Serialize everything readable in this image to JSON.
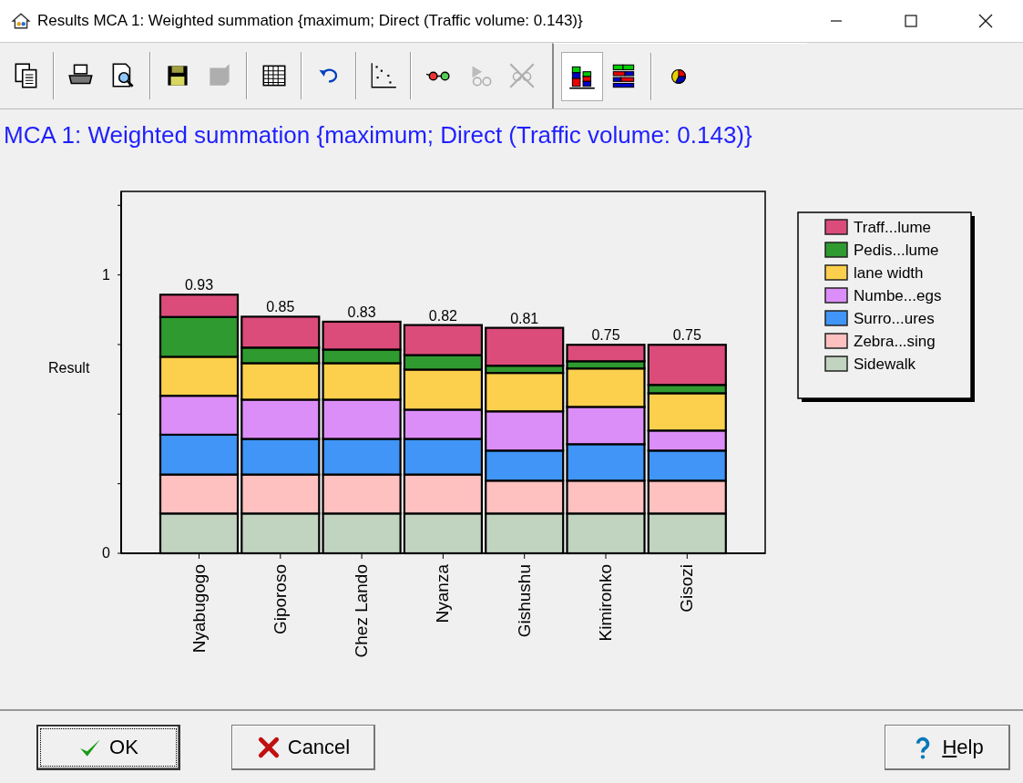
{
  "window": {
    "title": "Results MCA 1: Weighted summation {maximum; Direct (Traffic volume: 0.143)}"
  },
  "toolbar": [
    {
      "kind": "copy",
      "disabled": false
    },
    {
      "kind": "sep"
    },
    {
      "kind": "print",
      "disabled": false
    },
    {
      "kind": "preview",
      "disabled": false
    },
    {
      "kind": "sep"
    },
    {
      "kind": "save",
      "disabled": false
    },
    {
      "kind": "square",
      "disabled": true
    },
    {
      "kind": "sep"
    },
    {
      "kind": "table",
      "disabled": false
    },
    {
      "kind": "sep"
    },
    {
      "kind": "undo",
      "disabled": false
    },
    {
      "kind": "sep"
    },
    {
      "kind": "scatter",
      "disabled": false
    },
    {
      "kind": "sep"
    },
    {
      "kind": "glasses",
      "disabled": false
    },
    {
      "kind": "glasses2",
      "disabled": true
    },
    {
      "kind": "glassesx",
      "disabled": true
    }
  ],
  "view_toolbar": [
    {
      "kind": "stacked",
      "selected": true
    },
    {
      "kind": "hbars",
      "selected": false
    },
    {
      "kind": "sep"
    },
    {
      "kind": "pie",
      "selected": false
    }
  ],
  "heading": "MCA 1: Weighted summation {maximum; Direct (Traffic volume: 0.143)}",
  "chart": {
    "chart_data": {
      "type": "bar",
      "stacked": true,
      "legend": "right",
      "ylabel": "Result",
      "ylim": [
        0,
        1.3
      ],
      "yticks": [
        {
          "value": 0,
          "label": "0"
        },
        {
          "value": 1,
          "label": "1"
        }
      ],
      "categories": [
        "Nyabugogo",
        "Giporoso",
        "Chez Lando",
        "Nyanza",
        "Gishushu",
        "Kimironko",
        "Gisozi"
      ],
      "value_labels": [
        "0.93",
        "0.85",
        "0.83",
        "0.82",
        "0.81",
        "0.75",
        "0.75"
      ],
      "series": [
        {
          "name": "Traff...lume",
          "color": "#db4c7b",
          "values": [
            0.08,
            0.111,
            0.1,
            0.108,
            0.136,
            0.059,
            0.144
          ]
        },
        {
          "name": "Pedis...lume",
          "color": "#2f9a2f",
          "values": [
            0.143,
            0.056,
            0.049,
            0.052,
            0.026,
            0.026,
            0.03
          ]
        },
        {
          "name": "lane width",
          "color": "#fcd04c",
          "values": [
            0.14,
            0.131,
            0.131,
            0.144,
            0.138,
            0.138,
            0.134
          ]
        },
        {
          "name": "Numbe...egs",
          "color": "#dc8ef8",
          "values": [
            0.14,
            0.141,
            0.141,
            0.105,
            0.141,
            0.134,
            0.072
          ]
        },
        {
          "name": "Surro...ures",
          "color": "#4095f6",
          "values": [
            0.143,
            0.128,
            0.128,
            0.128,
            0.108,
            0.131,
            0.108
          ]
        },
        {
          "name": "Zebra...sing",
          "color": "#ffc0c0",
          "values": [
            0.14,
            0.14,
            0.14,
            0.14,
            0.118,
            0.118,
            0.118
          ]
        },
        {
          "name": "Sidewalk",
          "color": "#c0d4c0",
          "values": [
            0.143,
            0.143,
            0.143,
            0.143,
            0.143,
            0.143,
            0.143
          ]
        }
      ]
    }
  },
  "buttons": [
    {
      "kind": "ok",
      "label": "OK",
      "focused": true
    },
    {
      "kind": "cancel",
      "label": "Cancel",
      "focused": false
    },
    {
      "kind": "help",
      "label": "Help",
      "focused": false
    }
  ]
}
